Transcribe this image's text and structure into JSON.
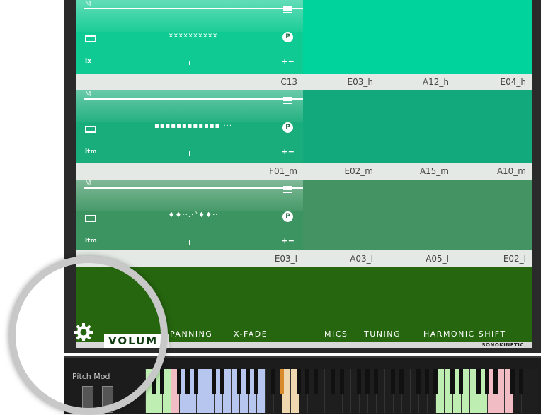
{
  "rows": [
    {
      "id": "h",
      "top_label": "M",
      "bottom_label": "lx",
      "pattern": "xxxxxxxxxx",
      "colors": {
        "ctrl": "#0fca92",
        "cells": "#00d39b"
      },
      "cell_labels": [
        "C13",
        "E03_h",
        "A12_h",
        "E04_h"
      ]
    },
    {
      "id": "m",
      "top_label": "M",
      "bottom_label": "ltm",
      "pattern": "▪▪▪▪▪▪▪▪▪▪▪▪ ···",
      "colors": {
        "ctrl": "#18ad7a",
        "cells": "#12aa7c"
      },
      "cell_labels": [
        "F01_m",
        "E02_m",
        "A15_m",
        "A10_m"
      ]
    },
    {
      "id": "l",
      "top_label": "M",
      "bottom_label": "ltm",
      "pattern": "♦♦··.·°♦♦··",
      "colors": {
        "ctrl": "#3c9461",
        "cells": "#449363"
      },
      "cell_labels": [
        "E03_l",
        "A03_l",
        "A05_l",
        "E02_l"
      ]
    }
  ],
  "tabs": {
    "volume": "VOLUM",
    "panning": "PANNING",
    "xfade": "X-FADE",
    "mics": "MICS",
    "tuning": "TUNING",
    "harmonic": "HARMONIC SHIFT"
  },
  "brand": "SONOKINETIC",
  "keyboard": {
    "pitch_mod": "Pitch Mod"
  },
  "colors": {
    "bottom_panel": "#26660f",
    "accent_orange": "#d98a2a",
    "key_blue": "#b6c6ee",
    "key_pink": "#f1bcc4",
    "key_green": "#bfeeb3"
  },
  "icons": [
    "menu-icon",
    "envelope-icon",
    "p-icon",
    "gear-icon"
  ]
}
